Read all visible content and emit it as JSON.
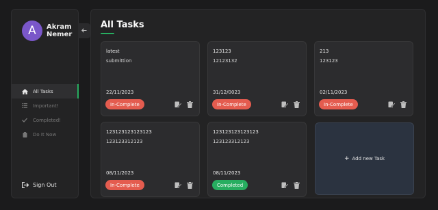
{
  "user": {
    "initial": "A",
    "first_name": "Akram",
    "last_name": "Nemer"
  },
  "sidebar": {
    "collapse_icon": "arrow-left-icon",
    "items": [
      {
        "label": "All Tasks",
        "icon": "home-icon",
        "active": true
      },
      {
        "label": "Important!",
        "icon": "list-icon",
        "active": false
      },
      {
        "label": "Completed!",
        "icon": "check-icon",
        "active": false
      },
      {
        "label": "Do It Now",
        "icon": "clipboard-icon",
        "active": false
      }
    ],
    "signout_label": "Sign Out"
  },
  "main": {
    "title": "All Tasks",
    "accent_color": "#27ae60",
    "add_label": "Add new Task",
    "tasks": [
      {
        "title": "latest",
        "description": "submittion",
        "date": "22/11/2023",
        "status": "In-Complete"
      },
      {
        "title": "123123",
        "description": "12123132",
        "date": "31/12/0023",
        "status": "In-Complete"
      },
      {
        "title": "213",
        "description": "123123",
        "date": "02/11/2023",
        "status": "In-Complete"
      },
      {
        "title": "123123123123123",
        "description": "123123312123",
        "date": "08/11/2023",
        "status": "In-Complete"
      },
      {
        "title": "123123123123123",
        "description": "123123312123",
        "date": "08/11/2023",
        "status": "Completed"
      }
    ]
  },
  "colors": {
    "incomplete": "#e45c4f",
    "completed": "#27ae60",
    "avatar": "#7a57c9"
  }
}
